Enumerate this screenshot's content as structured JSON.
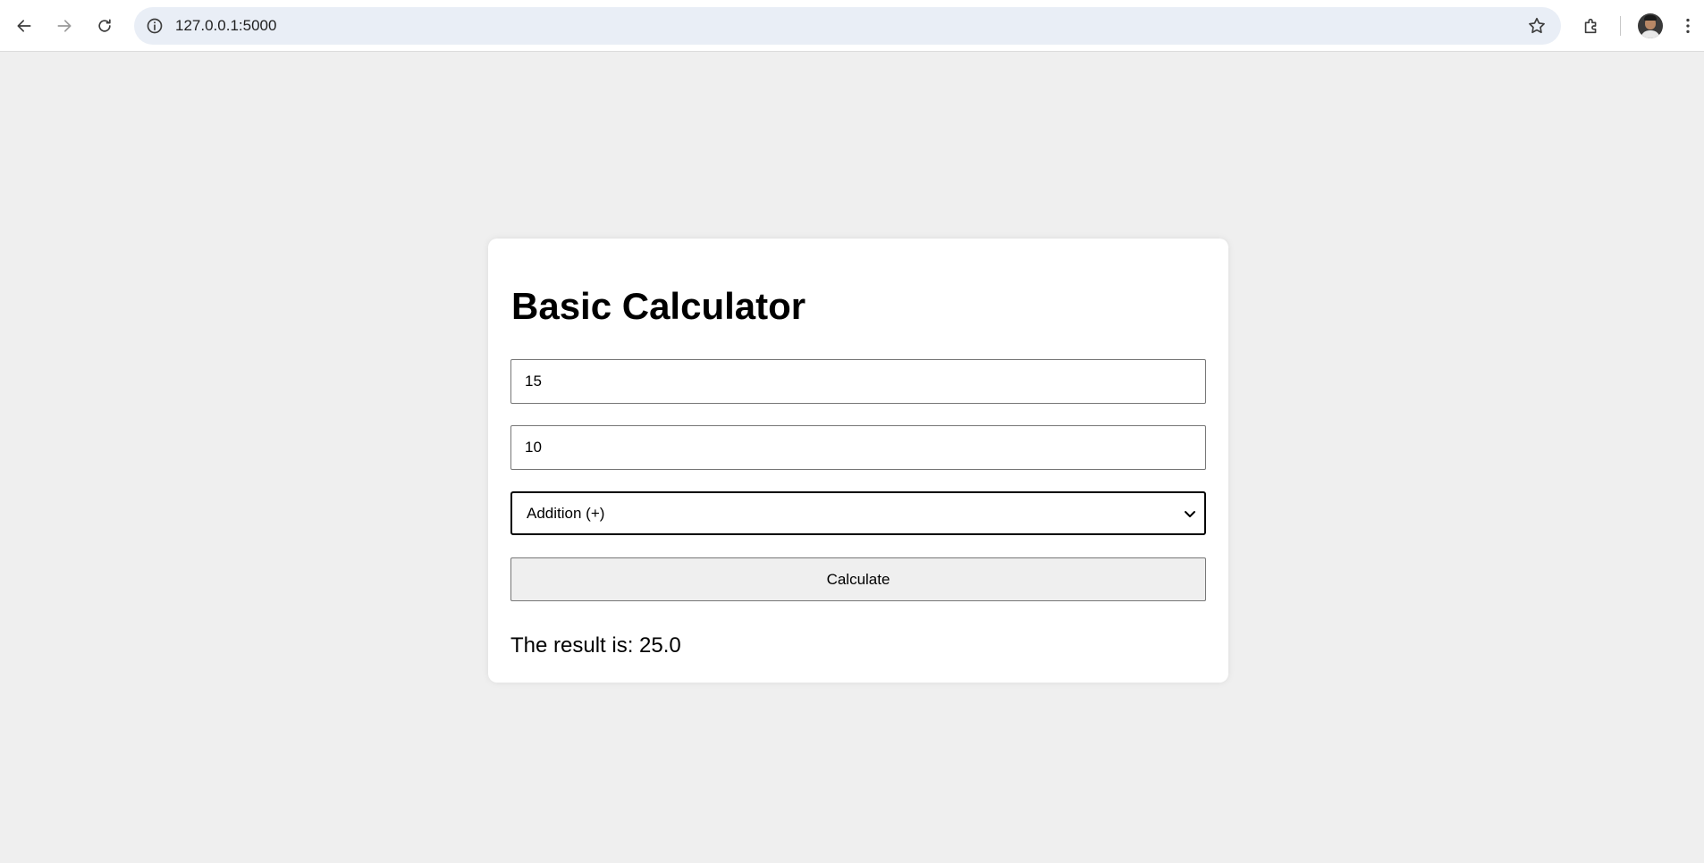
{
  "browser": {
    "url": "127.0.0.1:5000"
  },
  "calculator": {
    "title": "Basic Calculator",
    "number1": "15",
    "number2": "10",
    "operation_selected": "Addition (+)",
    "calculate_label": "Calculate",
    "result_text": "The result is: 25.0"
  },
  "icons": {
    "back": "back-arrow-icon",
    "forward": "forward-arrow-icon",
    "reload": "reload-icon",
    "site_info": "info-icon",
    "bookmark": "star-icon",
    "extensions": "puzzle-icon",
    "profile": "avatar",
    "menu": "kebab-menu-icon"
  }
}
